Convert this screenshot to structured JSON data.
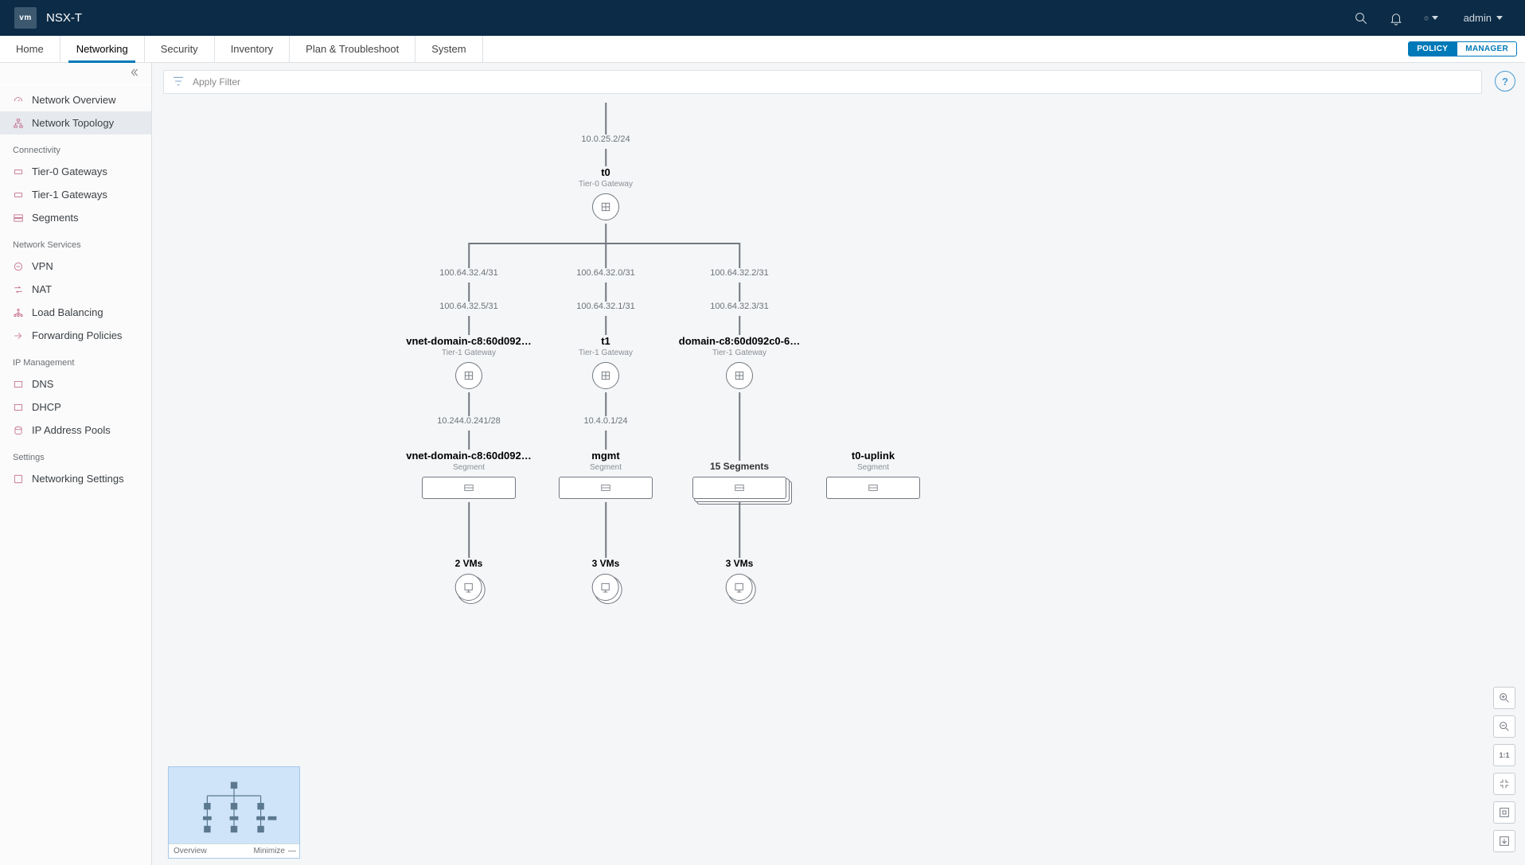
{
  "brand": {
    "logo": "vm",
    "name": "NSX-T"
  },
  "topbar": {
    "user": "admin"
  },
  "nav": {
    "tabs": [
      "Home",
      "Networking",
      "Security",
      "Inventory",
      "Plan & Troubleshoot",
      "System"
    ],
    "active": "Networking",
    "mode_policy": "POLICY",
    "mode_manager": "MANAGER"
  },
  "sidebar": {
    "top": [
      {
        "label": "Network Overview"
      },
      {
        "label": "Network Topology"
      }
    ],
    "active": "Network Topology",
    "groups": [
      {
        "header": "Connectivity",
        "items": [
          "Tier-0 Gateways",
          "Tier-1 Gateways",
          "Segments"
        ]
      },
      {
        "header": "Network Services",
        "items": [
          "VPN",
          "NAT",
          "Load Balancing",
          "Forwarding Policies"
        ]
      },
      {
        "header": "IP Management",
        "items": [
          "DNS",
          "DHCP",
          "IP Address Pools"
        ]
      },
      {
        "header": "Settings",
        "items": [
          "Networking Settings"
        ]
      }
    ]
  },
  "filter": {
    "placeholder": "Apply Filter"
  },
  "minimap": {
    "title": "Overview",
    "minimize": "Minimize"
  },
  "topology": {
    "uplink_ip": "10.0.25.2/24",
    "t0": {
      "name": "t0",
      "type": "Tier-0 Gateway"
    },
    "link_ips_top": [
      "100.64.32.4/31",
      "100.64.32.0/31",
      "100.64.32.2/31"
    ],
    "link_ips_bottom": [
      "100.64.32.5/31",
      "100.64.32.1/31",
      "100.64.32.3/31"
    ],
    "t1": [
      {
        "name": "vnet-domain-c8:60d092…",
        "type": "Tier-1 Gateway"
      },
      {
        "name": "t1",
        "type": "Tier-1 Gateway"
      },
      {
        "name": "domain-c8:60d092c0-6…",
        "type": "Tier-1 Gateway"
      }
    ],
    "seg_ips": [
      "10.244.0.241/28",
      "10.4.0.1/24"
    ],
    "segments": [
      {
        "name": "vnet-domain-c8:60d092…",
        "type": "Segment"
      },
      {
        "name": "mgmt",
        "type": "Segment"
      },
      {
        "count_label": "15 Segments"
      },
      {
        "name": "t0-uplink",
        "type": "Segment"
      }
    ],
    "vms": [
      "2 VMs",
      "3 VMs",
      "3 VMs"
    ]
  }
}
